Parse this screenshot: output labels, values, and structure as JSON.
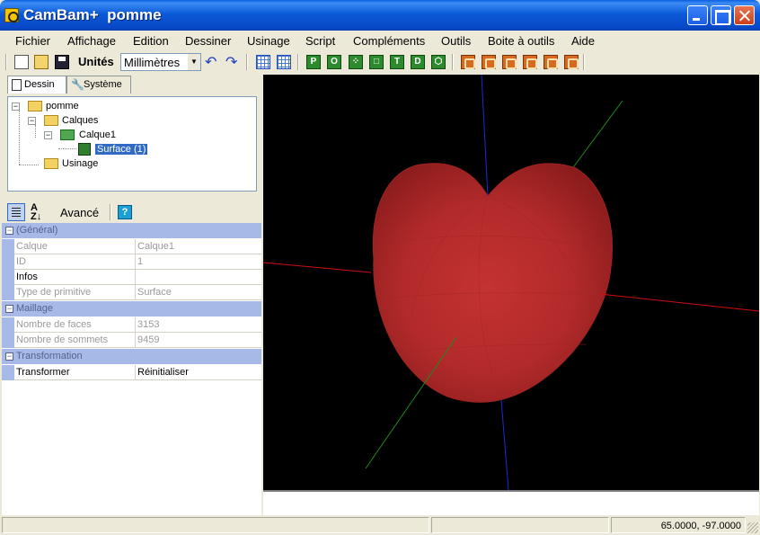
{
  "window": {
    "title": "CamBam+  pomme"
  },
  "menu": [
    "Fichier",
    "Affichage",
    "Edition",
    "Dessiner",
    "Usinage",
    "Script",
    "Compléments",
    "Outils",
    "Boite à outils",
    "Aide"
  ],
  "toolbar": {
    "units_label": "Unités",
    "units_value": "Millimètres",
    "undo_icon": "undo-icon",
    "redo_icon": "redo-icon",
    "draw_tool_letters": [
      "P",
      "O",
      "⁘",
      "□",
      "T",
      "D",
      "⬡"
    ]
  },
  "tabs": {
    "dessin": "Dessin",
    "systeme": "Système"
  },
  "tree": {
    "root": "pomme",
    "calques": "Calques",
    "calque1": "Calque1",
    "surface": "Surface (1)",
    "usinage": "Usinage"
  },
  "property_toolbar": {
    "advanced_label": "Avancé",
    "help_label": "?"
  },
  "properties": {
    "general": {
      "title": "(Général)",
      "rows": [
        {
          "name": "Calque",
          "value": "Calque1"
        },
        {
          "name": "ID",
          "value": "1"
        },
        {
          "name": "Infos",
          "value": ""
        },
        {
          "name": "Type de primitive",
          "value": "Surface"
        }
      ]
    },
    "maillage": {
      "title": "Maillage",
      "rows": [
        {
          "name": "Nombre de faces",
          "value": "3153"
        },
        {
          "name": "Nombre de sommets",
          "value": "9459"
        }
      ]
    },
    "transformation": {
      "title": "Transformation",
      "rows": [
        {
          "name": "Transformer",
          "value": "Réinitialiser"
        }
      ]
    }
  },
  "status": {
    "coordinates": "65.0000, -97.0000"
  },
  "colors": {
    "viewport_bg": "#000000",
    "axis_x": "#d01010",
    "axis_y": "#1e8a1e",
    "axis_z": "#1a2ad8",
    "apple": "#b52828",
    "selection": "#316ac5"
  }
}
